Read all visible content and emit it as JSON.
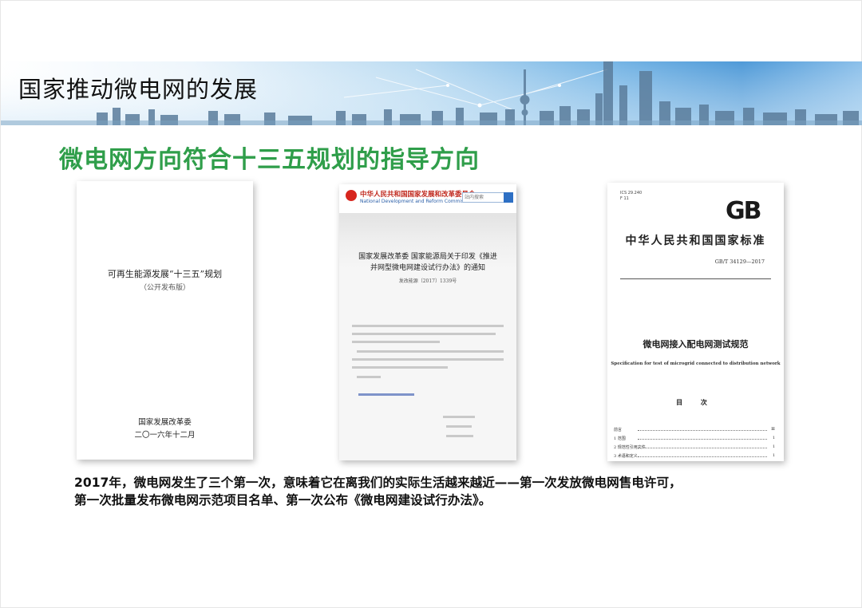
{
  "banner": {
    "title": "国家推动微电网的发展"
  },
  "subtitle": "微电网方向符合十三五规划的指导方向",
  "documents": {
    "plan": {
      "title": "可再生能源发展“十三五”规划",
      "subtitle": "（公开发布版）",
      "issuer": "国家发展改革委",
      "date": "二〇一六年十二月"
    },
    "notice": {
      "org_cn": "中华人民共和国国家发展和改革委员会",
      "org_en": "National Development and Reform Commission",
      "search_placeholder": "站内搜索",
      "title_line1": "国家发展改革委 国家能源局关于印发《推进",
      "title_line2": "并网型微电网建设试行办法》的通知",
      "doc_number": "发改能源〔2017〕1339号",
      "attachment": "附件：推进并网型微电网建设试行办法",
      "sign1": "国家发展改革委",
      "sign2": "国家能源局"
    },
    "standard": {
      "logo": "GB",
      "ics": "ICS 29.240",
      "ccs": "F 11",
      "header": "中华人民共和国国家标准",
      "number": "GB/T 34129—2017",
      "title": "微电网接入配电网测试规范",
      "title_en": "Specification for test of microgrid connected to distribution network",
      "toc": "目 次",
      "toc_items": [
        {
          "label": "前言",
          "page": "Ⅲ"
        },
        {
          "label": "1 范围",
          "page": "1"
        },
        {
          "label": "2 规范性引用文件",
          "page": "1"
        },
        {
          "label": "3 术语和定义",
          "page": "1"
        }
      ]
    }
  },
  "caption": {
    "line1": "2017年，微电网发生了三个第一次，意味着它在离我们的实际生活越来越近——第一次发放微电网售电许可，",
    "line2": "第一次批量发布微电网示范项目名单、第一次公布《微电网建设试行办法》。"
  }
}
